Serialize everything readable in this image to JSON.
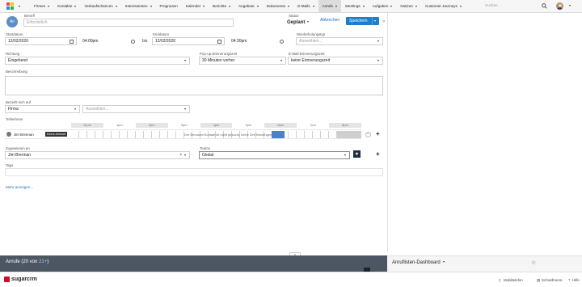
{
  "nav": {
    "items": [
      {
        "label": "Firmen",
        "active": false
      },
      {
        "label": "Kontakte",
        "active": false
      },
      {
        "label": "Verkaufschancen",
        "active": false
      },
      {
        "label": "Interessenten",
        "active": false
      },
      {
        "label": "Prognosen",
        "active": false,
        "no_caret": true
      },
      {
        "label": "Kalender",
        "active": false
      },
      {
        "label": "Berichte",
        "active": false
      },
      {
        "label": "Angebote",
        "active": false
      },
      {
        "label": "Dokumente",
        "active": false
      },
      {
        "label": "E-Mails",
        "active": false
      },
      {
        "label": "Anrufe",
        "active": true
      },
      {
        "label": "Meetings",
        "active": false
      },
      {
        "label": "Aufgaben",
        "active": false
      },
      {
        "label": "Notizen",
        "active": false
      },
      {
        "label": "Customer Journeys",
        "active": false
      }
    ],
    "search_placeholder": "Suchen"
  },
  "header": {
    "avatar_initials": "An",
    "subject_label": "Betreff",
    "subject_placeholder": "Erforderlich",
    "status_label": "Status",
    "status_value": "Geplant",
    "cancel_label": "Abbrechen",
    "save_label": "Speichern"
  },
  "form": {
    "start_label": "Startdatum",
    "start_date": "12/02/2020",
    "start_time": "04:00pm",
    "bis": "bis",
    "end_label": "Enddatum",
    "end_date": "12/02/2020",
    "end_time": "04:30pm",
    "repeat_label": "Wiederholungstyp",
    "repeat_placeholder": "Auswählen...",
    "direction_label": "Richtung",
    "direction_value": "Eingehend",
    "popup_label": "Pop-up-Erinnerungszeit",
    "popup_value": "30 Minuten vorher",
    "email_reminder_label": "E-Mail-Erinnerungszeit",
    "email_reminder_value": "keine Erinnerungszeit",
    "description_label": "Beschreibung",
    "related_label": "Bezieht sich auf",
    "related_type": "Firma",
    "related_placeholder": "Auswählen...",
    "participants_label": "Teilnehmer",
    "assigned_label": "Zugewiesen an",
    "assigned_value": "Jim Brennan",
    "teams_label": "Teams",
    "teams_value": "Global",
    "tags_label": "Tags",
    "more_link": "Mehr anzeigen..."
  },
  "scheduler": {
    "times": [
      "12pm",
      "1pm",
      "2pm",
      "3pm",
      "4pm",
      "5pm",
      "6pm",
      "7pm",
      "8pm"
    ],
    "participant_name": "Jim Brennan",
    "no_answer_badge": "Keine Antwort",
    "busy_text": "Der Benutzer/Kontakt ist nicht gesucht, keine Zeit hinzufügen…"
  },
  "bottom": {
    "list_title": "Anrufe (20 von ",
    "list_count": "21+",
    "list_close": ")",
    "dashboard_title": "Anruflisten-Dashboard"
  },
  "footer": {
    "brand": "sugarcrm",
    "mobile": "Mobiltelefon",
    "shortcuts": "Schnellmenü",
    "help": "Hilfe"
  }
}
